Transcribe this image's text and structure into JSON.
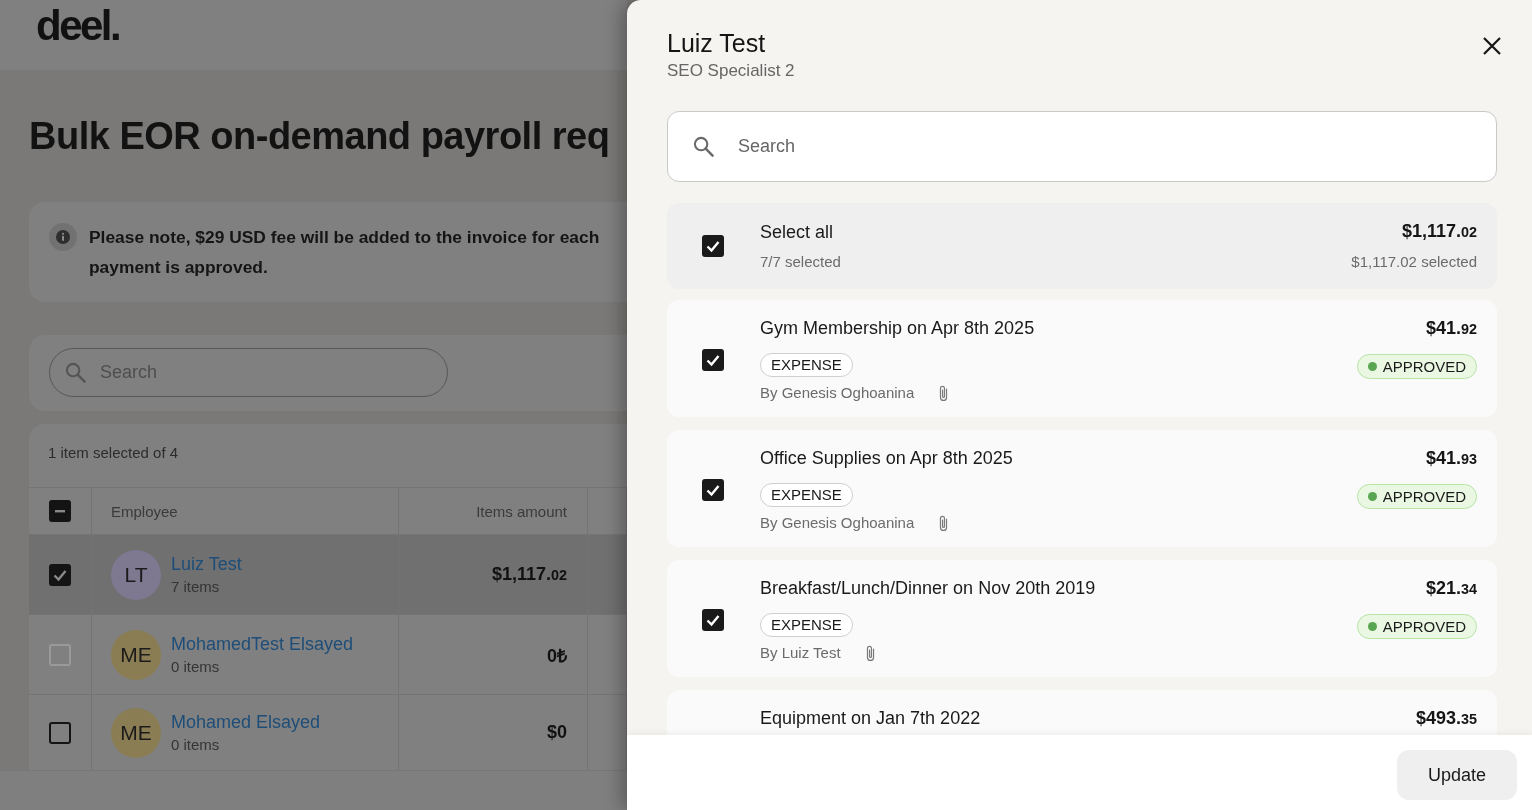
{
  "page": {
    "logo": "deel.",
    "title": "Bulk EOR on-demand payroll req",
    "notice": {
      "text": "Please note, $29 USD fee will be added to the invoice for each\npayment is approved."
    },
    "search": {
      "placeholder": "Search"
    },
    "table": {
      "summary": "1 item selected of 4",
      "select_all": {
        "indeterminate": true
      },
      "columns": [
        "Employee",
        "Items amount"
      ],
      "rows": [
        {
          "checked": true,
          "disabled": false,
          "avatar": {
            "initials": "LT",
            "color": "#7e7891"
          },
          "name": "Luiz Test",
          "items": "7 items",
          "amount": {
            "whole": "$1,117.",
            "cents": "02"
          }
        },
        {
          "checked": false,
          "disabled": true,
          "avatar": {
            "initials": "ME",
            "color": "#8b7d53"
          },
          "name": "MohamedTest Elsayed",
          "items": "0 items",
          "amount": {
            "whole": "0₺"
          }
        },
        {
          "checked": false,
          "disabled": false,
          "avatar": {
            "initials": "ME",
            "color": "#8b7d53"
          },
          "name": "Mohamed Elsayed",
          "items": "0 items",
          "amount": {
            "whole": "$0"
          }
        }
      ]
    }
  },
  "drawer": {
    "title": "Luiz Test",
    "subtitle": "SEO Specialist 2",
    "search": {
      "placeholder": "Search"
    },
    "select_all": {
      "label": "Select all",
      "checked": true,
      "count": "7/7 selected",
      "amount": {
        "whole": "$1,117.",
        "cents": "02"
      },
      "selected_amount": "$1,117.02 selected"
    },
    "items": [
      {
        "checked": true,
        "title": "Gym Membership on Apr 8th 2025",
        "tag": "EXPENSE",
        "byline": "By Genesis Oghoanina",
        "attachment": true,
        "amount": {
          "whole": "$41.",
          "cents": "92"
        },
        "status": {
          "label": "APPROVED",
          "kind": "approved"
        }
      },
      {
        "checked": true,
        "title": "Office Supplies on Apr 8th 2025",
        "tag": "EXPENSE",
        "byline": "By Genesis Oghoanina",
        "attachment": true,
        "amount": {
          "whole": "$41.",
          "cents": "93"
        },
        "status": {
          "label": "APPROVED",
          "kind": "approved"
        }
      },
      {
        "checked": true,
        "title": "Breakfast/Lunch/Dinner on Nov 20th 2019",
        "tag": "EXPENSE",
        "byline": "By Luiz Test",
        "attachment": true,
        "amount": {
          "whole": "$21.",
          "cents": "34"
        },
        "status": {
          "label": "APPROVED",
          "kind": "approved"
        }
      },
      {
        "title": "Equipment on Jan 7th 2022",
        "amount": {
          "whole": "$493.",
          "cents": "35"
        }
      }
    ],
    "update_button": "Update"
  }
}
